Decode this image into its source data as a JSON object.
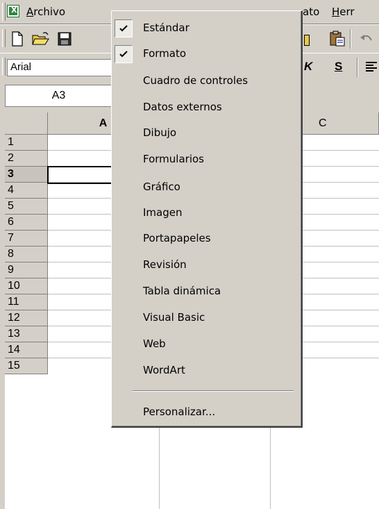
{
  "menubar": {
    "items": [
      {
        "label": "Archivo"
      },
      {
        "label": "ato"
      },
      {
        "label": "Herr"
      }
    ]
  },
  "toolbar2": {
    "font_name": "Arial",
    "buttons": [
      "K",
      "S"
    ]
  },
  "name_box": {
    "value": "A3"
  },
  "grid": {
    "columns": [
      "A",
      "C"
    ],
    "rows": [
      "1",
      "2",
      "3",
      "4",
      "5",
      "6",
      "7",
      "8",
      "9",
      "10",
      "11",
      "12",
      "13",
      "14",
      "15"
    ],
    "active_row": "3"
  },
  "dropdown": {
    "items": [
      {
        "label": "Estándar",
        "checked": true
      },
      {
        "label": "Formato",
        "checked": true
      },
      {
        "label": "Cuadro de controles",
        "checked": false
      },
      {
        "label": "Datos externos",
        "checked": false
      },
      {
        "label": "Dibujo",
        "checked": false
      },
      {
        "label": "Formularios",
        "checked": false
      },
      {
        "label": "Gráfico",
        "checked": false
      },
      {
        "label": "Imagen",
        "checked": false
      },
      {
        "label": "Portapapeles",
        "checked": false
      },
      {
        "label": "Revisión",
        "checked": false
      },
      {
        "label": "Tabla dinámica",
        "checked": false
      },
      {
        "label": "Visual Basic",
        "checked": false
      },
      {
        "label": "Web",
        "checked": false
      },
      {
        "label": "WordArt",
        "checked": false
      }
    ],
    "customize_label": "Personalizar..."
  },
  "icons": {
    "app": "excel-app-icon",
    "new": "new-document-icon",
    "open": "open-folder-icon",
    "save": "save-disk-icon",
    "paste": "paste-clipboard-icon",
    "undo": "undo-arrow-icon",
    "check": "checkmark-icon",
    "align": "align-left-icon"
  },
  "colors": {
    "face": "#d4d0c8",
    "shadow": "#808080",
    "highlight": "#ffffff",
    "gridline": "#c0c0c0"
  }
}
